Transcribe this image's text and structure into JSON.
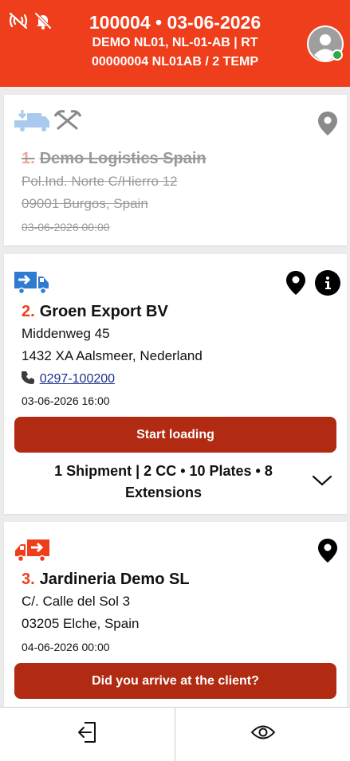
{
  "header": {
    "title": "100004 • 03-06-2026",
    "line2": "DEMO NL01, NL-01-AB | RT",
    "line3": "00000004 NL01AB / 2 TEMP"
  },
  "stops": [
    {
      "number": "1.",
      "name": "Demo Logistics Spain",
      "address1": "Pol.Ind. Norte C/Hierro 12",
      "address2": "09001 Burgos, Spain",
      "datetime": "03-06-2026 00:00"
    },
    {
      "number": "2.",
      "name": "Groen Export BV",
      "address1": "Middenweg 45",
      "address2": "1432 XA Aalsmeer, Nederland",
      "phone": "0297-100200",
      "datetime": "03-06-2026 16:00",
      "action": "Start loading",
      "summary": "1 Shipment | 2 CC • 10 Plates • 8 Extensions"
    },
    {
      "number": "3.",
      "name": "Jardineria Demo SL",
      "address1": "C/. Calle del Sol 3",
      "address2": "03205 Elche, Spain",
      "datetime": "04-06-2026 00:00",
      "action": "Did you arrive at the client?"
    }
  ],
  "colors": {
    "brand": "#ef3e1c",
    "button": "#b12a12",
    "done_icon": "#a9c9ee",
    "truck_blue": "#2e7bd1",
    "online": "#2da84a"
  },
  "icons": {
    "header": [
      "nfc-signal-icon",
      "bell-off-icon"
    ],
    "bottom": [
      "logout-icon",
      "eye-icon"
    ]
  }
}
